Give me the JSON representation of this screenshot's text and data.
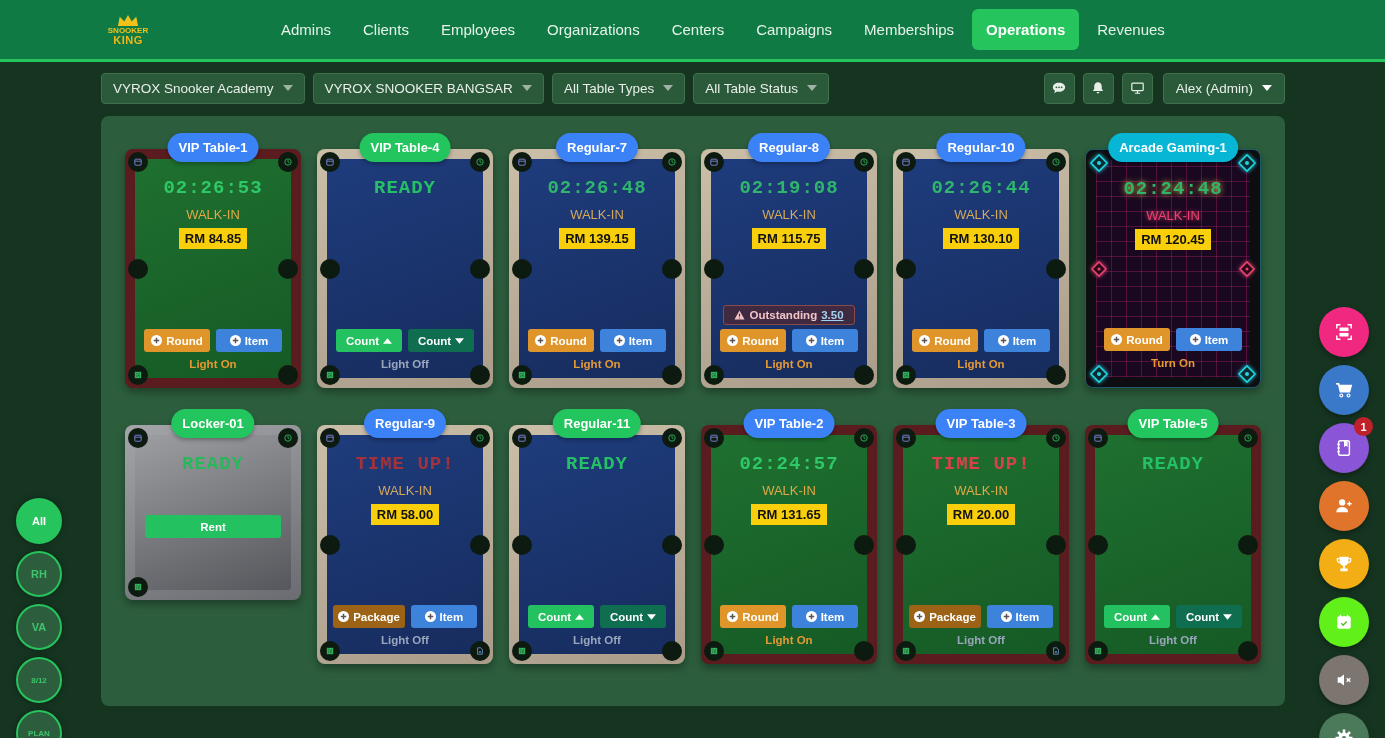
{
  "header": {
    "logo": {
      "line1": "SNOOKER",
      "line2": "KING"
    },
    "nav": [
      {
        "label": "Admins",
        "selected": false
      },
      {
        "label": "Clients",
        "selected": false
      },
      {
        "label": "Employees",
        "selected": false
      },
      {
        "label": "Organizations",
        "selected": false
      },
      {
        "label": "Centers",
        "selected": false
      },
      {
        "label": "Campaigns",
        "selected": false
      },
      {
        "label": "Memberships",
        "selected": false
      },
      {
        "label": "Operations",
        "selected": true
      },
      {
        "label": "Revenues",
        "selected": false
      }
    ]
  },
  "filters": [
    {
      "label": "VYROX Snooker Academy"
    },
    {
      "label": "VYROX SNOOKER BANGSAR"
    },
    {
      "label": "All Table Types"
    },
    {
      "label": "All Table Status"
    }
  ],
  "toolbar": [
    {
      "kind": "chat"
    },
    {
      "kind": "bell"
    },
    {
      "kind": "monitor"
    }
  ],
  "user_menu": {
    "label": "Alex (Admin)"
  },
  "tables": [
    {
      "name": "VIP Table-1",
      "kind": "vip",
      "status": {
        "kind": "timer",
        "text": "02:26:53"
      },
      "customer": "WALK-IN",
      "amount": "RM 84.85",
      "actions": [
        {
          "kind": "round",
          "label": "Round"
        },
        {
          "kind": "item",
          "label": "Item"
        }
      ],
      "light": {
        "label": "Light On",
        "on": true
      },
      "note": false
    },
    {
      "name": "VIP Table-4",
      "kind": "regular",
      "status": {
        "kind": "ready",
        "text": "READY"
      },
      "actions": [
        {
          "kind": "count_up",
          "label": "Count"
        },
        {
          "kind": "count_down",
          "label": "Count"
        }
      ],
      "light": {
        "label": "Light Off",
        "on": false
      },
      "note": false
    },
    {
      "name": "Regular-7",
      "kind": "regular",
      "status": {
        "kind": "timer",
        "text": "02:26:48"
      },
      "customer": "WALK-IN",
      "amount": "RM 139.15",
      "actions": [
        {
          "kind": "round",
          "label": "Round"
        },
        {
          "kind": "item",
          "label": "Item"
        }
      ],
      "light": {
        "label": "Light On",
        "on": true
      },
      "note": false
    },
    {
      "name": "Regular-8",
      "kind": "regular",
      "status": {
        "kind": "timer",
        "text": "02:19:08"
      },
      "customer": "WALK-IN",
      "amount": "RM 115.75",
      "outstanding": {
        "label": "Outstanding",
        "amount": "3.50"
      },
      "actions": [
        {
          "kind": "round",
          "label": "Round"
        },
        {
          "kind": "item",
          "label": "Item"
        }
      ],
      "light": {
        "label": "Light On",
        "on": true
      },
      "note": false
    },
    {
      "name": "Regular-10",
      "kind": "regular",
      "status": {
        "kind": "timer",
        "text": "02:26:44"
      },
      "customer": "WALK-IN",
      "amount": "RM 130.10",
      "actions": [
        {
          "kind": "round",
          "label": "Round"
        },
        {
          "kind": "item",
          "label": "Item"
        }
      ],
      "light": {
        "label": "Light On",
        "on": true
      },
      "note": false
    },
    {
      "name": "Arcade Gaming-1",
      "kind": "arcade",
      "status": {
        "kind": "timer",
        "text": "02:24:48"
      },
      "customer": "WALK-IN",
      "amount": "RM 120.45",
      "actions": [
        {
          "kind": "round",
          "label": "Round"
        },
        {
          "kind": "item",
          "label": "Item"
        }
      ],
      "light": {
        "label": "Turn On",
        "on": true
      }
    },
    {
      "name": "Locker-01",
      "kind": "locker",
      "status": {
        "kind": "ready",
        "text": "READY"
      },
      "actions": [
        {
          "kind": "rent",
          "label": "Rent"
        }
      ]
    },
    {
      "name": "Regular-9",
      "kind": "regular",
      "status": {
        "kind": "timeup",
        "text": "TIME UP!"
      },
      "customer": "WALK-IN",
      "amount": "RM 58.00",
      "actions": [
        {
          "kind": "package",
          "label": "Package"
        },
        {
          "kind": "item",
          "label": "Item"
        }
      ],
      "light": {
        "label": "Light Off",
        "on": false
      },
      "note": true
    },
    {
      "name": "Regular-11",
      "kind": "regular",
      "status": {
        "kind": "ready",
        "text": "READY"
      },
      "actions": [
        {
          "kind": "count_up",
          "label": "Count"
        },
        {
          "kind": "count_down",
          "label": "Count"
        }
      ],
      "light": {
        "label": "Light Off",
        "on": false
      },
      "note": false
    },
    {
      "name": "VIP Table-2",
      "kind": "vip",
      "status": {
        "kind": "timer",
        "text": "02:24:57"
      },
      "customer": "WALK-IN",
      "amount": "RM 131.65",
      "actions": [
        {
          "kind": "round",
          "label": "Round"
        },
        {
          "kind": "item",
          "label": "Item"
        }
      ],
      "light": {
        "label": "Light On",
        "on": true
      },
      "note": false
    },
    {
      "name": "VIP Table-3",
      "kind": "vip",
      "status": {
        "kind": "timeup",
        "text": "TIME UP!"
      },
      "customer": "WALK-IN",
      "amount": "RM 20.00",
      "actions": [
        {
          "kind": "package",
          "label": "Package"
        },
        {
          "kind": "item",
          "label": "Item"
        }
      ],
      "light": {
        "label": "Light Off",
        "on": false
      },
      "note": true
    },
    {
      "name": "VIP Table-5",
      "kind": "vip",
      "status": {
        "kind": "ready",
        "text": "READY"
      },
      "actions": [
        {
          "kind": "count_up",
          "label": "Count"
        },
        {
          "kind": "count_down",
          "label": "Count"
        }
      ],
      "light": {
        "label": "Light Off",
        "on": false
      },
      "note": false
    }
  ],
  "group_filters": [
    {
      "label": "All",
      "selected": true
    },
    {
      "label": "RH",
      "selected": false
    },
    {
      "label": "VA",
      "selected": false
    },
    {
      "label": "8/12",
      "selected": false
    },
    {
      "label": "PLAN",
      "selected": false
    }
  ],
  "quick_actions": [
    {
      "kind": "scan",
      "color": "#f0287f"
    },
    {
      "kind": "cart",
      "color": "#3a78c9"
    },
    {
      "kind": "notebook",
      "color": "#8a55d6",
      "badge": "1"
    },
    {
      "kind": "user_add",
      "color": "#e0742a"
    },
    {
      "kind": "trophy",
      "color": "#f2ae14"
    },
    {
      "kind": "calendar",
      "color": "#62f01a"
    },
    {
      "kind": "mute",
      "color": "#7d7670"
    },
    {
      "kind": "settings",
      "color": "#4a7a5a"
    }
  ]
}
